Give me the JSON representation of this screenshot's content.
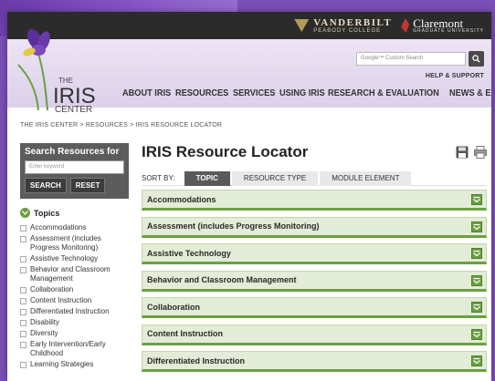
{
  "topbar": {
    "vanderbilt_name": "VANDERBILT",
    "vanderbilt_sub": "PEABODY COLLEGE",
    "claremont_name": "Claremont",
    "claremont_sub": "GRADUATE UNIVERSITY"
  },
  "header": {
    "logo_the": "THE",
    "logo_iris": "IRIS",
    "logo_center": "CENTER",
    "search_placeholder": "Google™ Custom Search",
    "help_link": "HELP & SUPPORT",
    "nav": [
      "ABOUT IRIS",
      "RESOURCES",
      "SERVICES",
      "USING IRIS",
      "RESEARCH & EVALUATION",
      "NEWS & EVENTS"
    ]
  },
  "breadcrumb": "THE IRIS CENTER  >  RESOURCES  >  IRIS RESOURCE LOCATOR",
  "sidebar": {
    "title": "Search Resources for",
    "keyword_placeholder": "Enter keyword",
    "search_label": "SEARCH",
    "reset_label": "RESET",
    "topics_label": "Topics",
    "topics": [
      "Accommodations",
      "Assessment (includes Progress Monitoring)",
      "Assistive Technology",
      "Behavior and Classroom Management",
      "Collaboration",
      "Content Instruction",
      "Differentiated Instruction",
      "Disability",
      "Diversity",
      "Early Intervention/Early Childhood",
      "Learning Strategies"
    ]
  },
  "main": {
    "title": "IRIS Resource Locator",
    "sort_by_label": "SORT BY:",
    "sort_tabs": [
      "TOPIC",
      "RESOURCE TYPE",
      "MODULE ELEMENT"
    ],
    "active_sort": "TOPIC",
    "sections": [
      "Accommodations",
      "Assessment (includes Progress Monitoring)",
      "Assistive Technology",
      "Behavior and Classroom Management",
      "Collaboration",
      "Content Instruction",
      "Differentiated Instruction"
    ]
  },
  "colors": {
    "accent_green": "#6aa043",
    "header_purple": "#dcd0ea",
    "dark_bar": "#2b2b2b"
  },
  "icons": {
    "save": "floppy-disk-icon",
    "print": "printer-icon",
    "search_go": "magnifier-icon",
    "topics_toggle": "chevron-down-icon",
    "section_expand": "chevron-down-icon"
  }
}
